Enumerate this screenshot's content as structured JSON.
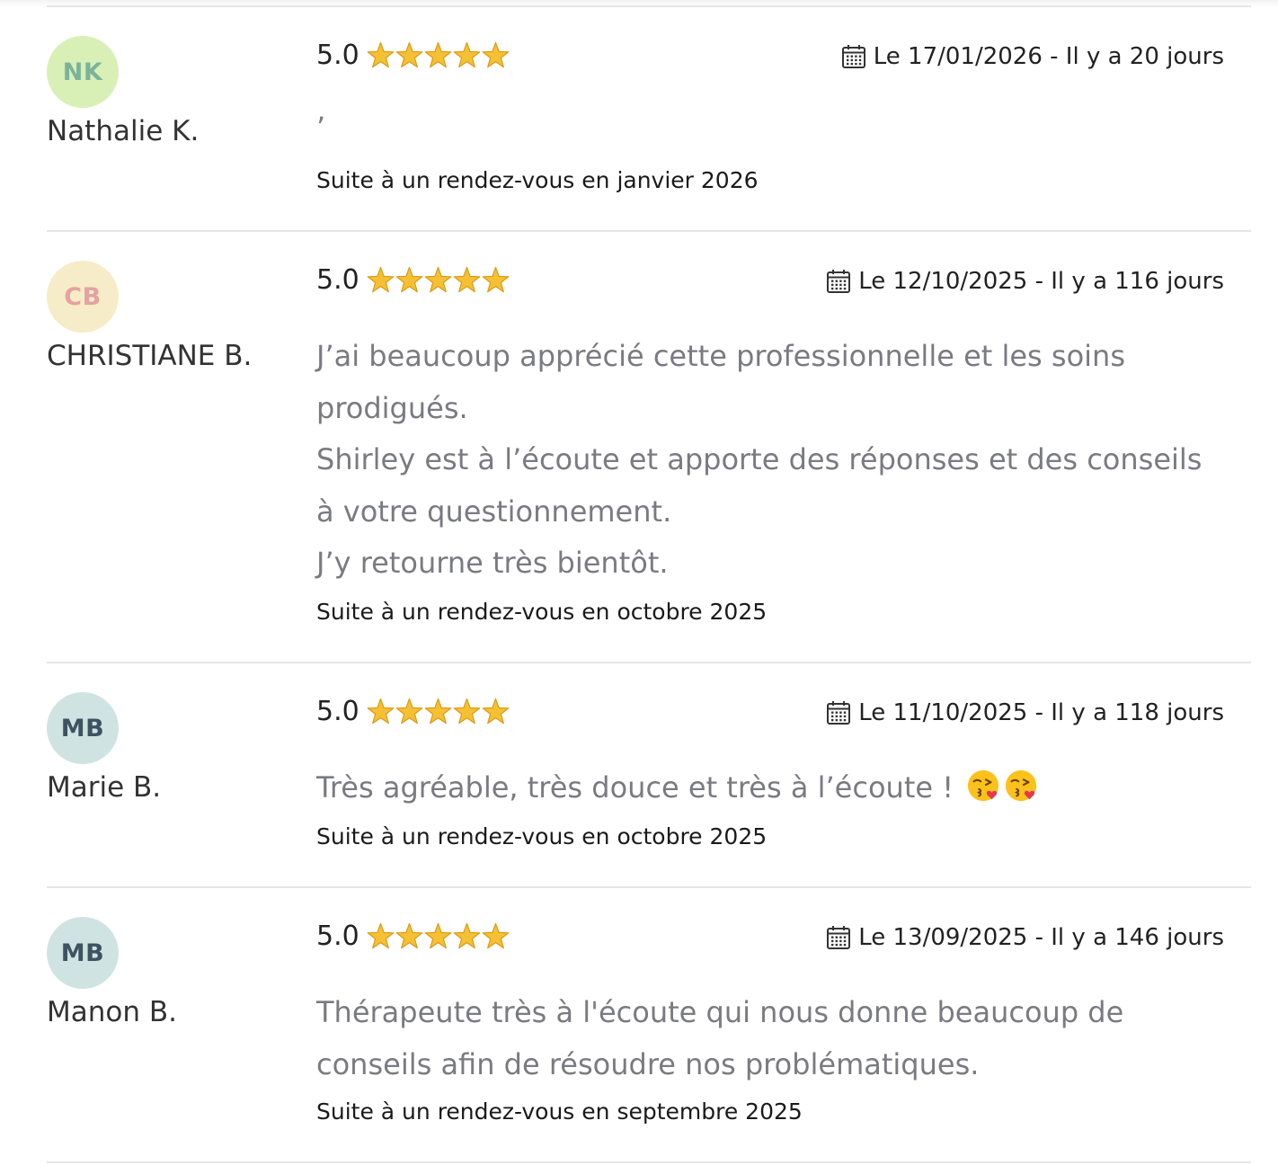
{
  "reviews": [
    {
      "initials": "NK",
      "avatar_bg": "#d8f0b6",
      "avatar_fg": "#7bb39a",
      "name": "Nathalie K.",
      "score": "5.0",
      "stars": 5,
      "date": "Le 17/01/2026 - Il y a 20 jours",
      "text_lines": [
        "’"
      ],
      "visit": "Suite à un rendez-vous en janvier 2026"
    },
    {
      "initials": "CB",
      "avatar_bg": "#f7ecc8",
      "avatar_fg": "#e4a2a2",
      "name": "CHRISTIANE B.",
      "score": "5.0",
      "stars": 5,
      "date": "Le 12/10/2025 - Il y a 116 jours",
      "text_lines": [
        "J’ai beaucoup apprécié cette professionnelle et les soins",
        "prodigués.",
        "Shirley est à l’écoute et apporte des réponses et des conseils",
        "à votre questionnement.",
        "J’y retourne très bientôt."
      ],
      "visit": "Suite à un rendez-vous en octobre 2025"
    },
    {
      "initials": "MB",
      "avatar_bg": "#cfe4e2",
      "avatar_fg": "#3e5360",
      "name": "Marie B.",
      "score": "5.0",
      "stars": 5,
      "date": "Le 11/10/2025 - Il y a 118 jours",
      "text_lines": [
        "Très agréable, très douce et très à l’écoute !"
      ],
      "emoji": [
        "face-blowing-kiss-icon",
        "face-blowing-kiss-icon"
      ],
      "visit": "Suite à un rendez-vous en octobre 2025"
    },
    {
      "initials": "MB",
      "avatar_bg": "#cfe4e2",
      "avatar_fg": "#3e5360",
      "name": "Manon B.",
      "score": "5.0",
      "stars": 5,
      "date": "Le 13/09/2025 - Il y a 146 jours",
      "text_lines": [
        "Thérapeute très à l'écoute qui nous donne beaucoup de",
        "conseils afin de résoudre nos problématiques."
      ],
      "visit": "Suite à un rendez-vous en septembre 2025"
    }
  ],
  "colors": {
    "star": "#f5c033",
    "star_outline": "#d99a12",
    "divider": "#e6e6e6",
    "review_text": "#7a7a82"
  },
  "icons": {
    "star": "star-icon",
    "calendar": "calendar-icon"
  }
}
